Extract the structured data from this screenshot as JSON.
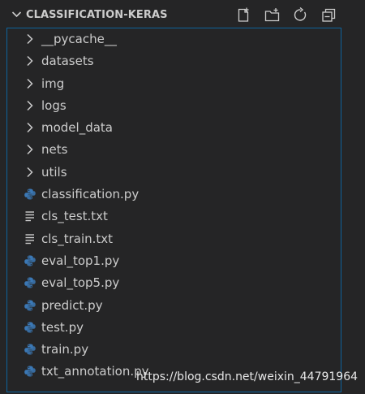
{
  "explorer": {
    "title": "CLASSIFICATION-KERAS",
    "actions": [
      {
        "name": "new-file-icon"
      },
      {
        "name": "new-folder-icon"
      },
      {
        "name": "refresh-icon"
      },
      {
        "name": "collapse-all-icon"
      }
    ],
    "items": [
      {
        "label": "__pycache__",
        "kind": "folder",
        "icon": "chevron-right-icon"
      },
      {
        "label": "datasets",
        "kind": "folder",
        "icon": "chevron-right-icon"
      },
      {
        "label": "img",
        "kind": "folder",
        "icon": "chevron-right-icon"
      },
      {
        "label": "logs",
        "kind": "folder",
        "icon": "chevron-right-icon"
      },
      {
        "label": "model_data",
        "kind": "folder",
        "icon": "chevron-right-icon"
      },
      {
        "label": "nets",
        "kind": "folder",
        "icon": "chevron-right-icon"
      },
      {
        "label": "utils",
        "kind": "folder",
        "icon": "chevron-right-icon"
      },
      {
        "label": "classification.py",
        "kind": "python",
        "icon": "python-file-icon"
      },
      {
        "label": "cls_test.txt",
        "kind": "text",
        "icon": "text-file-icon"
      },
      {
        "label": "cls_train.txt",
        "kind": "text",
        "icon": "text-file-icon"
      },
      {
        "label": "eval_top1.py",
        "kind": "python",
        "icon": "python-file-icon"
      },
      {
        "label": "eval_top5.py",
        "kind": "python",
        "icon": "python-file-icon"
      },
      {
        "label": "predict.py",
        "kind": "python",
        "icon": "python-file-icon"
      },
      {
        "label": "test.py",
        "kind": "python",
        "icon": "python-file-icon"
      },
      {
        "label": "train.py",
        "kind": "python",
        "icon": "python-file-icon"
      },
      {
        "label": "txt_annotation.py",
        "kind": "python",
        "icon": "python-file-icon"
      }
    ]
  },
  "watermark": "https://blog.csdn.net/weixin_44791964",
  "colors": {
    "background": "#252526",
    "text": "#cccccc",
    "focus_border": "#0e639c",
    "python_blue": "#3b78b5",
    "python_yellow": "#f5d24b"
  }
}
